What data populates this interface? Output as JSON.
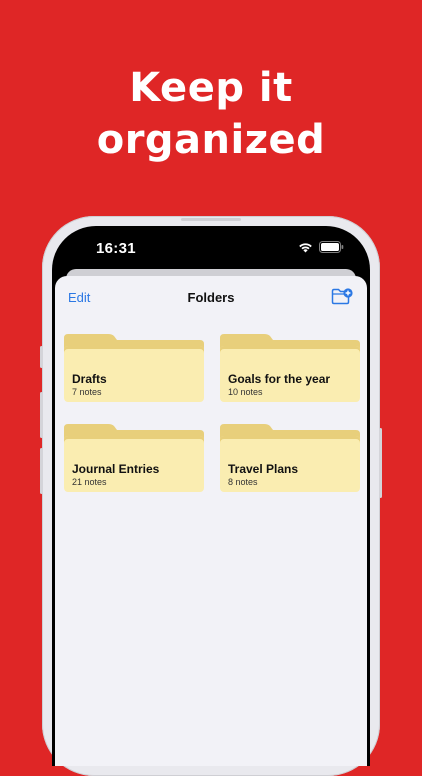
{
  "headline": {
    "line1": "Keep it",
    "line2": "organized"
  },
  "status_bar": {
    "time": "16:31"
  },
  "navbar": {
    "edit_label": "Edit",
    "title": "Folders"
  },
  "folders": [
    {
      "name": "Drafts",
      "count": "7 notes"
    },
    {
      "name": "Goals for the year",
      "count": "10 notes"
    },
    {
      "name": "Journal Entries",
      "count": "21 notes"
    },
    {
      "name": "Travel Plans",
      "count": "8 notes"
    }
  ],
  "colors": {
    "background": "#df2626",
    "accent": "#2b78e4",
    "folder_body": "#faedb1",
    "folder_tab": "#e8cf7b",
    "sheet": "#f2f2f7"
  },
  "icons": [
    "wifi-icon",
    "battery-icon",
    "new-folder-icon",
    "folder-icon"
  ]
}
